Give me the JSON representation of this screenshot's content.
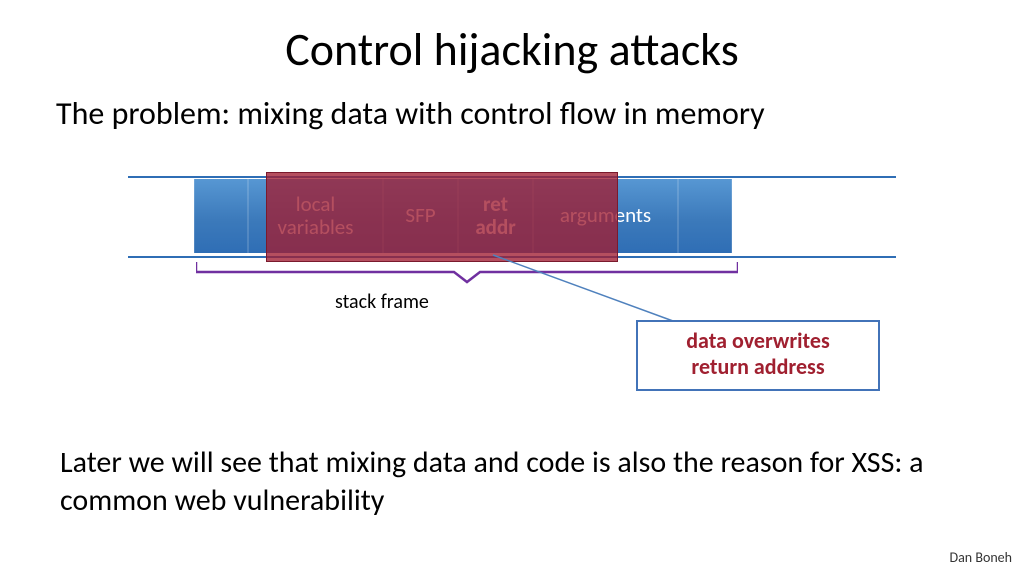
{
  "title": "Control hijacking attacks",
  "subtitle": "The problem:   mixing data with control flow in memory",
  "segments": {
    "local": "local\nvariables",
    "sfp": "SFP",
    "ret": "ret\naddr",
    "args": "arguments"
  },
  "bracket_label": "stack frame",
  "callout": {
    "line1": "data overwrites",
    "line2": "return address"
  },
  "footer": "Later we will see that mixing data and code is also the reason for XSS: a common web vulnerability",
  "author": "Dan Boneh",
  "colors": {
    "bar": "#2F6EB5",
    "overflow": "#A02030",
    "bracket": "#7030A0",
    "callout_border": "#4273B8"
  }
}
